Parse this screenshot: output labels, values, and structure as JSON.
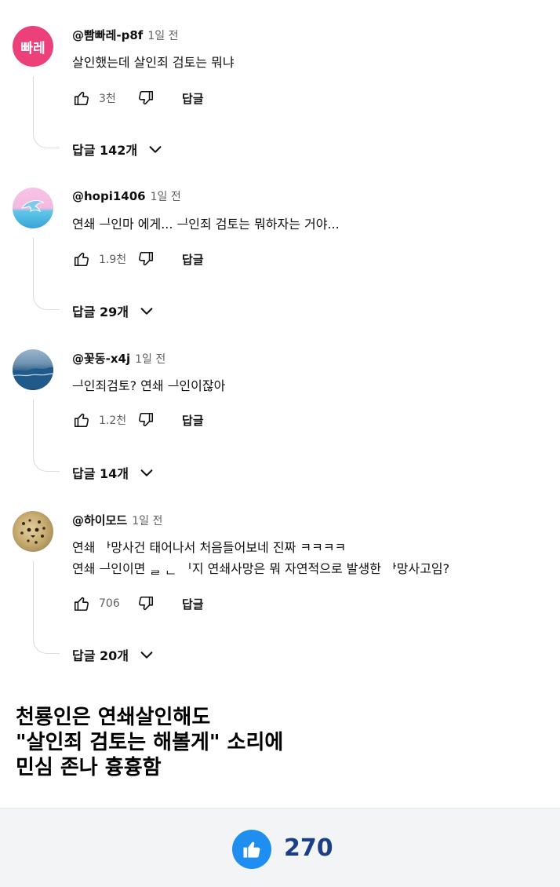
{
  "comments": [
    {
      "handle": "@빰빠레-p8f",
      "time": "1일 전",
      "avatar_text": "빠레",
      "lines": [
        "살인했는데 살인죄 검토는 뭐냐"
      ],
      "likes": "3천",
      "reply_label": "답글",
      "replies": "답글 142개"
    },
    {
      "handle": "@hopi1406",
      "time": "1일 전",
      "lines": [
        "연쇄 ᆜ인마 에게... ᆜ인죄 검토는 뭐하자는 거야..."
      ],
      "likes": "1.9천",
      "reply_label": "답글",
      "replies": "답글 29개"
    },
    {
      "handle": "@꽃동-x4j",
      "time": "1일 전",
      "lines": [
        "ᆜ인죄검토? 연쇄 ᆜ인이잖아"
      ],
      "likes": "1.2천",
      "reply_label": "답글",
      "replies": "답글 14개"
    },
    {
      "handle": "@하이모드",
      "time": "1일 전",
      "lines": [
        "연쇄 ᅡ망사건 태어나서 처음들어보네 진짜 ㅋㅋㅋㅋ",
        "연쇄 ᆜ인이면 ᆯ ᆫ ᅵ지 연쇄사망은 뭐 자연적으로 발생한 ᅡ망사고임?"
      ],
      "likes": "706",
      "reply_label": "답글",
      "replies": "답글 20개"
    }
  ],
  "caption": [
    "천룡인은 연쇄살인해도",
    "\"살인죄 검토는 해볼게\" 소리에",
    "민심 존나 흉흉함"
  ],
  "footer": {
    "like_count": "270"
  },
  "colors": {
    "avatar1": "#ec407a",
    "footer_like": "#1e8ff0",
    "footer_count": "#1b3f86"
  }
}
